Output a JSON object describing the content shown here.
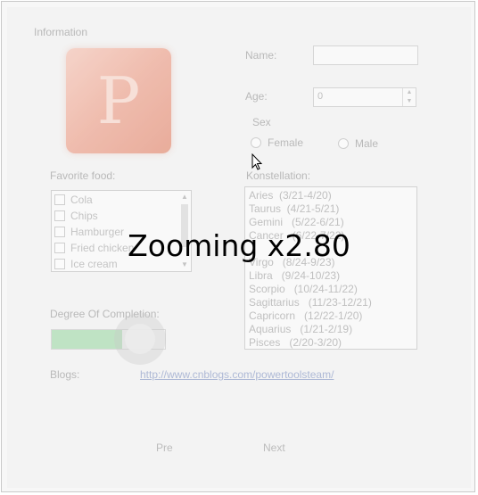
{
  "group_title": "Information",
  "name": {
    "label": "Name:",
    "value": ""
  },
  "age": {
    "label": "Age:",
    "value": "0"
  },
  "sex": {
    "label": "Sex",
    "options": [
      "Female",
      "Male"
    ]
  },
  "favorite_food": {
    "label": "Favorite food:",
    "items": [
      "Cola",
      "Chips",
      "Hamburger",
      "Fried chicken",
      "Ice cream"
    ]
  },
  "constellation": {
    "label": "Konstellation:",
    "items": [
      "Aries  (3/21-4/20)",
      "Taurus  (4/21-5/21)",
      "Gemini   (5/22-6/21)",
      "Cancer   (6/22-7/22)",
      "Virgo   (8/24-9/23)",
      "Libra   (9/24-10/23)",
      "Scorpio   (10/24-11/22)",
      "Sagittarius   (11/23-12/21)",
      "Capricorn   (12/22-1/20)",
      "Aquarius   (1/21-2/19)",
      "Pisces   (2/20-3/20)"
    ]
  },
  "completion": {
    "label": "Degree Of Completion:",
    "progress": 0.62
  },
  "blogs": {
    "label": "Blogs:",
    "url": "http://www.cnblogs.com/powertoolsteam/"
  },
  "nav": {
    "pre": "Pre",
    "next": "Next"
  },
  "overlay": {
    "zoom_text": "Zooming x2.80"
  },
  "colors": {
    "progress_fill": "#bfe3c4",
    "link": "#aeb9d6",
    "faded_text": "#b9b9b9"
  }
}
